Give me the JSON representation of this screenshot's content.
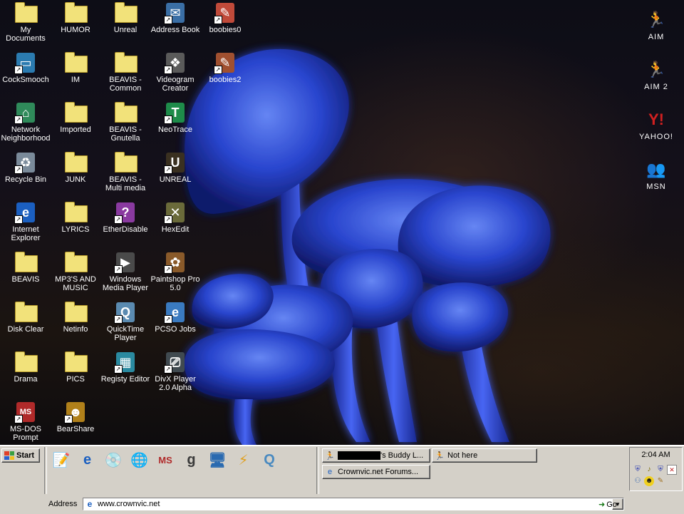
{
  "desktop_icons": [
    {
      "label": "My Documents",
      "icon": "my-documents-icon",
      "col": 0,
      "row": 0,
      "kind": "folder-doc"
    },
    {
      "label": "HUMOR",
      "icon": "folder-icon",
      "col": 1,
      "row": 0,
      "kind": "folder"
    },
    {
      "label": "Unreal",
      "icon": "folder-icon",
      "col": 2,
      "row": 0,
      "kind": "folder"
    },
    {
      "label": "Address Book",
      "icon": "address-book-icon",
      "col": 3,
      "row": 0,
      "kind": "gen",
      "glyph": "✉",
      "bg": "#3a6ea5"
    },
    {
      "label": "boobies0",
      "icon": "image-file-icon",
      "col": 4,
      "row": 0,
      "kind": "gen",
      "glyph": "✎",
      "bg": "#c04a3a"
    },
    {
      "label": "CockSmooch",
      "icon": "my-computer-icon",
      "col": 0,
      "row": 1,
      "kind": "gen",
      "glyph": "▭",
      "bg": "#2b7bb0"
    },
    {
      "label": "IM",
      "icon": "folder-icon",
      "col": 1,
      "row": 1,
      "kind": "folder"
    },
    {
      "label": "BEAVIS - Common",
      "icon": "shared-folder-icon",
      "col": 2,
      "row": 1,
      "kind": "folder"
    },
    {
      "label": "Videogram Creator",
      "icon": "videogram-icon",
      "col": 3,
      "row": 1,
      "kind": "gen",
      "glyph": "❖",
      "bg": "#5a5a5a"
    },
    {
      "label": "boobies2",
      "icon": "image-file-icon",
      "col": 4,
      "row": 1,
      "kind": "gen",
      "glyph": "✎",
      "bg": "#a05030"
    },
    {
      "label": "Network Neighborhood",
      "icon": "network-icon",
      "col": 0,
      "row": 2,
      "kind": "gen",
      "glyph": "⌂",
      "bg": "#2f8a5a"
    },
    {
      "label": "Imported",
      "icon": "folder-icon",
      "col": 1,
      "row": 2,
      "kind": "folder"
    },
    {
      "label": "BEAVIS - Gnutella",
      "icon": "shared-folder-icon",
      "col": 2,
      "row": 2,
      "kind": "folder"
    },
    {
      "label": "NeoTrace",
      "icon": "neotrace-icon",
      "col": 3,
      "row": 2,
      "kind": "gen",
      "glyph": "T",
      "bg": "#1e8c4a"
    },
    {
      "label": "Recycle Bin",
      "icon": "recycle-bin-icon",
      "col": 0,
      "row": 3,
      "kind": "gen",
      "glyph": "♻",
      "bg": "#7a8a9a"
    },
    {
      "label": "JUNK",
      "icon": "folder-icon",
      "col": 1,
      "row": 3,
      "kind": "folder"
    },
    {
      "label": "BEAVIS - Multi media",
      "icon": "shared-folder-icon",
      "col": 2,
      "row": 3,
      "kind": "folder"
    },
    {
      "label": "UNREAL",
      "icon": "unreal-icon",
      "col": 3,
      "row": 3,
      "kind": "gen",
      "glyph": "U",
      "bg": "#3a3020"
    },
    {
      "label": "Internet Explorer",
      "icon": "internet-explorer-icon",
      "col": 0,
      "row": 4,
      "kind": "gen",
      "glyph": "e",
      "bg": "#1b5fc0"
    },
    {
      "label": "LYRICS",
      "icon": "folder-icon",
      "col": 1,
      "row": 4,
      "kind": "folder"
    },
    {
      "label": "EtherDisable",
      "icon": "etherdisable-icon",
      "col": 2,
      "row": 4,
      "kind": "gen",
      "glyph": "?",
      "bg": "#8a3aa0"
    },
    {
      "label": "HexEdit",
      "icon": "hexedit-icon",
      "col": 3,
      "row": 4,
      "kind": "gen",
      "glyph": "✕",
      "bg": "#6a6a3a"
    },
    {
      "label": "BEAVIS",
      "icon": "folder-icon",
      "col": 0,
      "row": 5,
      "kind": "folder"
    },
    {
      "label": "MP3'S AND MUSIC",
      "icon": "folder-icon",
      "col": 1,
      "row": 5,
      "kind": "folder"
    },
    {
      "label": "Windows Media Player",
      "icon": "media-player-icon",
      "col": 2,
      "row": 5,
      "kind": "gen",
      "glyph": "▶",
      "bg": "#4a4a4a"
    },
    {
      "label": "Paintshop Pro 5.0",
      "icon": "paintshop-icon",
      "col": 3,
      "row": 5,
      "kind": "gen",
      "glyph": "✿",
      "bg": "#8a5a2a"
    },
    {
      "label": "Disk Clear",
      "icon": "folder-icon",
      "col": 0,
      "row": 6,
      "kind": "folder"
    },
    {
      "label": "Netinfo",
      "icon": "folder-icon",
      "col": 1,
      "row": 6,
      "kind": "folder"
    },
    {
      "label": "QuickTime Player",
      "icon": "quicktime-icon",
      "col": 2,
      "row": 6,
      "kind": "gen",
      "glyph": "Q",
      "bg": "#5a8ab0"
    },
    {
      "label": "PCSO Jobs",
      "icon": "internet-explorer-icon",
      "col": 3,
      "row": 6,
      "kind": "gen",
      "glyph": "e",
      "bg": "#3a7ac0"
    },
    {
      "label": "Drama",
      "icon": "folder-icon",
      "col": 0,
      "row": 7,
      "kind": "folder"
    },
    {
      "label": "PICS",
      "icon": "folder-icon",
      "col": 1,
      "row": 7,
      "kind": "folder"
    },
    {
      "label": "Registy Editor",
      "icon": "registry-editor-icon",
      "col": 2,
      "row": 7,
      "kind": "gen",
      "glyph": "▦",
      "bg": "#2a8aa0"
    },
    {
      "label": "DivX Player 2.0 Alpha",
      "icon": "divx-icon",
      "col": 3,
      "row": 7,
      "kind": "gen",
      "glyph": "⎚",
      "bg": "#404a50"
    },
    {
      "label": "MS-DOS Prompt",
      "icon": "ms-dos-icon",
      "col": 0,
      "row": 8,
      "kind": "gen",
      "glyph": "MS",
      "bg": "#b02a2a"
    },
    {
      "label": "BearShare",
      "icon": "bearshare-icon",
      "col": 1,
      "row": 8,
      "kind": "gen",
      "glyph": "☻",
      "bg": "#b0801a"
    }
  ],
  "right_icons": [
    {
      "label": "AIM",
      "icon": "aim-icon",
      "glyph": "🏃",
      "color": "#f0a020"
    },
    {
      "label": "AIM 2",
      "icon": "aim-icon",
      "glyph": "🏃",
      "color": "#f0a020"
    },
    {
      "label": "YAHOO!",
      "icon": "yahoo-icon",
      "glyph": "Y!",
      "color": "#d02020"
    },
    {
      "label": "MSN",
      "icon": "msn-icon",
      "glyph": "👥",
      "color": "#30a040"
    }
  ],
  "taskbar": {
    "start_label": "Start",
    "quick_launch": [
      {
        "icon": "notepad-icon",
        "glyph": "📝"
      },
      {
        "icon": "internet-explorer-icon",
        "glyph": "e"
      },
      {
        "icon": "cd-player-icon",
        "glyph": "💿"
      },
      {
        "icon": "globe-icon",
        "glyph": "🌐"
      },
      {
        "icon": "ms-dos-icon",
        "glyph": "MS"
      },
      {
        "icon": "google-icon",
        "glyph": "g"
      },
      {
        "icon": "my-computer-icon",
        "glyph": "🖥"
      },
      {
        "icon": "winamp-icon",
        "glyph": "⚡"
      },
      {
        "icon": "quicktime-icon",
        "glyph": "Q"
      }
    ],
    "tasks": [
      {
        "label": "'s Buddy L...",
        "icon": "aim-icon",
        "redacted": true
      },
      {
        "label": "Not here",
        "icon": "aim-icon",
        "redacted": false
      },
      {
        "label": "Crownvic.net Forums...",
        "icon": "internet-explorer-icon",
        "redacted": false
      }
    ],
    "clock": "2:04 AM",
    "address_label": "Address",
    "address_value": "www.crownvic.net",
    "go_label": "Go"
  }
}
